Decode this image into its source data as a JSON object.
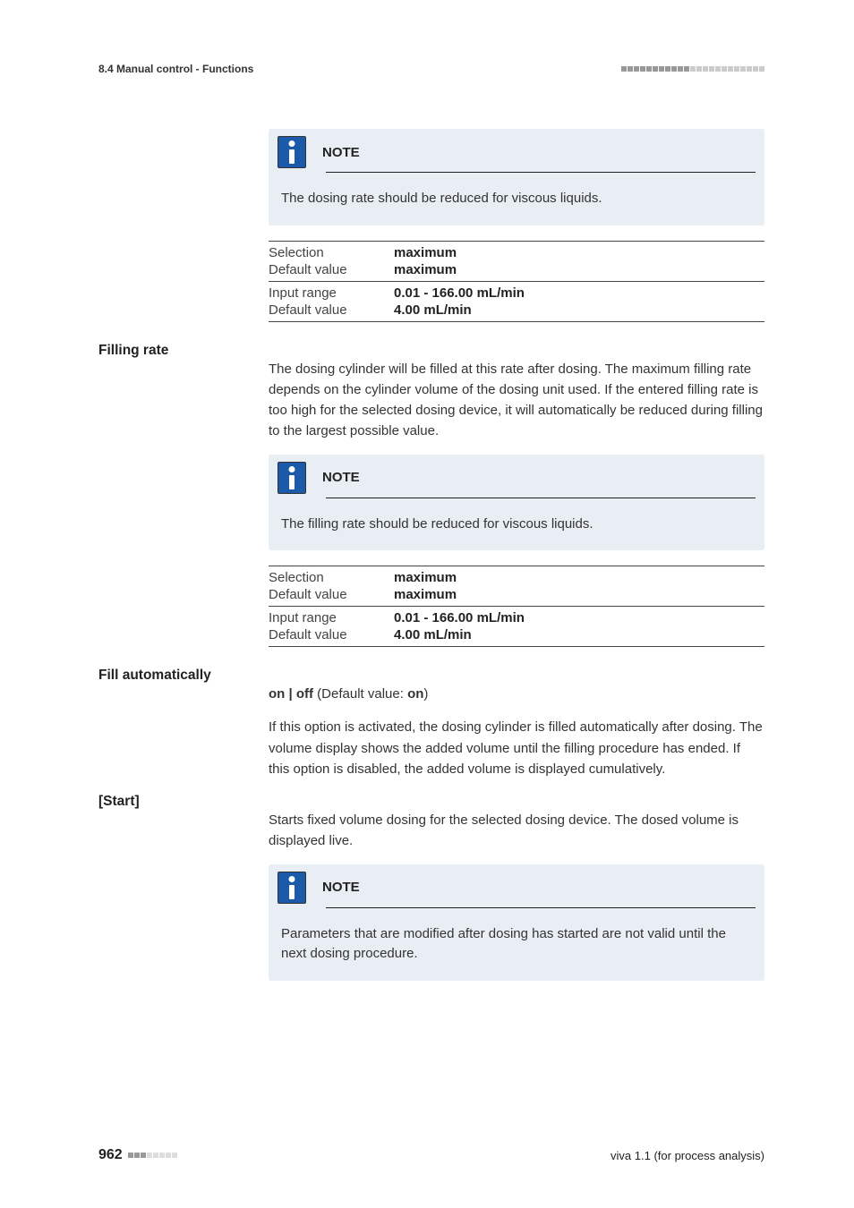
{
  "header": {
    "section": "8.4 Manual control - Functions"
  },
  "notes": {
    "label": "NOTE",
    "dosing_rate": "The dosing rate should be reduced for viscous liquids.",
    "filling_rate": "The filling rate should be reduced for viscous liquids.",
    "start_note": "Parameters that are modified after dosing has started are not valid until the next dosing procedure."
  },
  "params": {
    "selection_label": "Selection",
    "default_value_label": "Default value",
    "input_range_label": "Input range",
    "maximum": "maximum",
    "input_range_val": "0.01 - 166.00 mL/min",
    "default_rate": "4.00 mL/min"
  },
  "sections": {
    "filling_rate": {
      "label": "Filling rate",
      "text": "The dosing cylinder will be filled at this rate after dosing. The maximum filling rate depends on the cylinder volume of the dosing unit used. If the entered filling rate is too high for the selected dosing device, it will automatically be reduced during filling to the largest possible value."
    },
    "fill_auto": {
      "label": "Fill automatically",
      "options_prefix": "on | off",
      "options_mid": " (Default value: ",
      "options_val": "on",
      "options_suffix": ")",
      "text": "If this option is activated, the dosing cylinder is filled automatically after dosing. The volume display shows the added volume until the filling procedure has ended. If this option is disabled, the added volume is displayed cumulatively."
    },
    "start": {
      "label": "[Start]",
      "text": "Starts fixed volume dosing for the selected dosing device. The dosed volume is displayed live."
    }
  },
  "footer": {
    "page": "962",
    "right": "viva 1.1 (for process analysis)"
  }
}
